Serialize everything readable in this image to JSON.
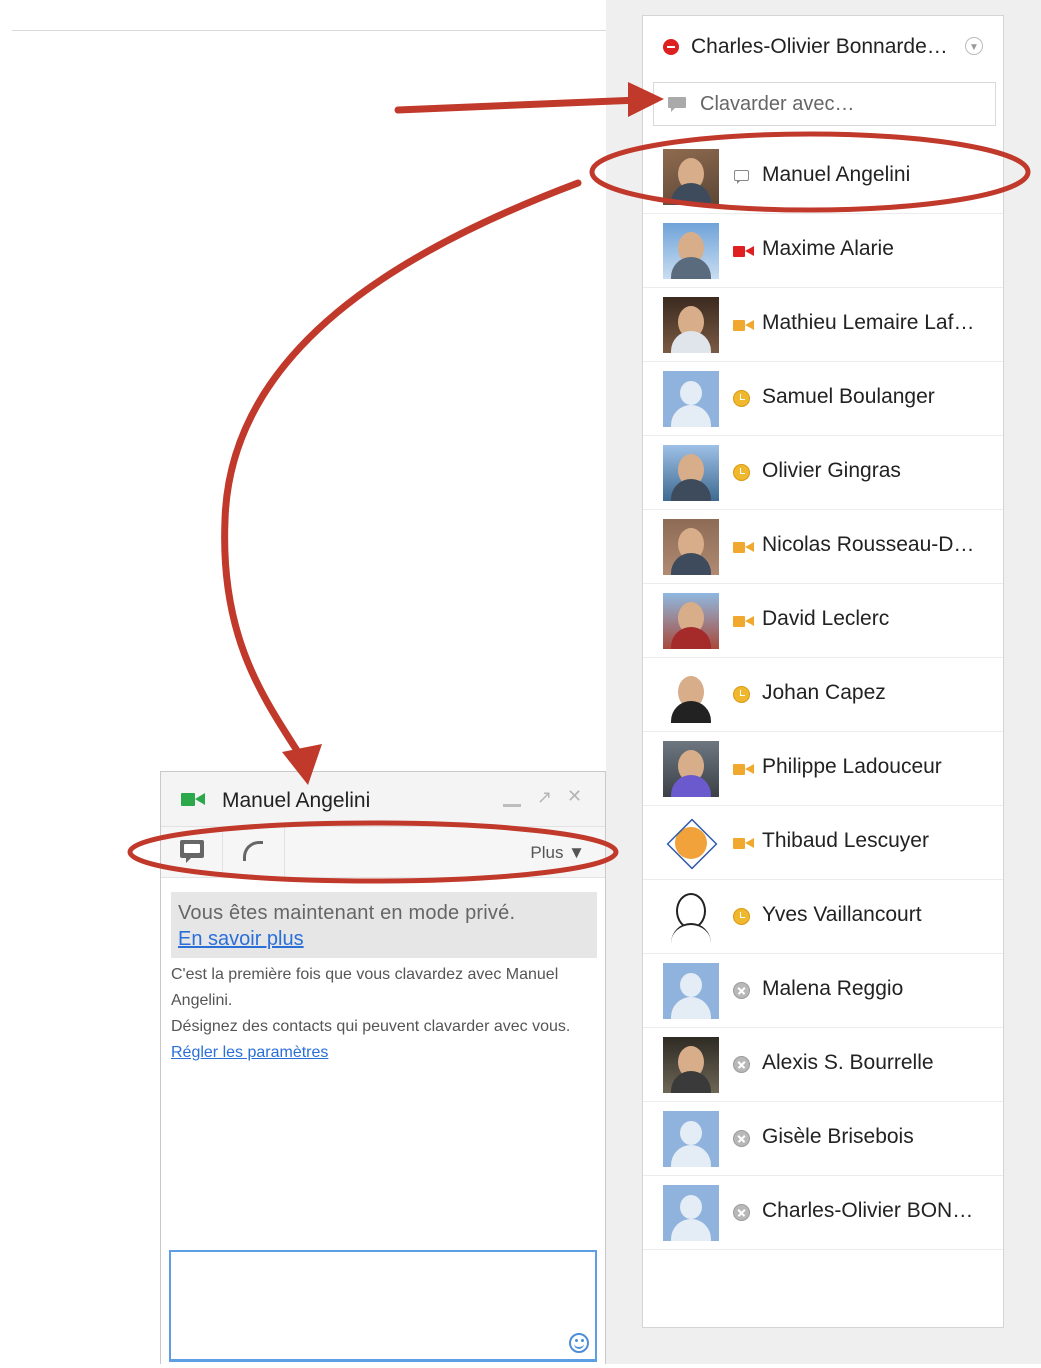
{
  "roster": {
    "me": {
      "name": "Charles-Olivier Bonnarde…",
      "status": "busy"
    },
    "chat_with_placeholder": "Clavarder avec…",
    "contacts": [
      {
        "name": "Manuel Angelini",
        "status": "chat"
      },
      {
        "name": "Maxime Alarie",
        "status": "video-busy"
      },
      {
        "name": "Mathieu Lemaire Laf…",
        "status": "video"
      },
      {
        "name": "Samuel Boulanger",
        "status": "idle"
      },
      {
        "name": "Olivier Gingras",
        "status": "idle"
      },
      {
        "name": "Nicolas Rousseau-D…",
        "status": "video"
      },
      {
        "name": "David Leclerc",
        "status": "video"
      },
      {
        "name": "Johan Capez",
        "status": "idle"
      },
      {
        "name": "Philippe Ladouceur",
        "status": "video"
      },
      {
        "name": "Thibaud Lescuyer",
        "status": "video"
      },
      {
        "name": "Yves Vaillancourt",
        "status": "idle"
      },
      {
        "name": "Malena Reggio",
        "status": "offline"
      },
      {
        "name": "Alexis S. Bourrelle",
        "status": "offline"
      },
      {
        "name": "Gisèle Brisebois",
        "status": "offline"
      },
      {
        "name": "Charles-Olivier BON…",
        "status": "offline"
      }
    ]
  },
  "chat_window": {
    "title": "Manuel Angelini",
    "more_label": "Plus ▼",
    "privacy_text": "Vous êtes maintenant en mode privé.",
    "privacy_link": "En savoir plus",
    "info_line1": "C'est la première fois que vous clavardez avec Manuel Angelini.",
    "info_line2": "Désignez des contacts qui peuvent clavarder avec vous.",
    "settings_link": "Régler les paramètres"
  },
  "colors": {
    "annotation": "#c0392b",
    "link": "#2a6fd8",
    "busy": "#dd2020",
    "video": "#f0a92e",
    "video_busy": "#e02020",
    "video_active": "#2aa84a",
    "idle": "#f0b82e",
    "offline": "#b8b8b8"
  }
}
